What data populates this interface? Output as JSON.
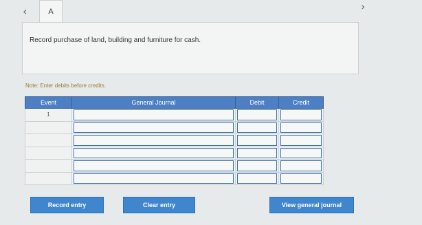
{
  "nav": {
    "prev_icon": "chevron-left-icon",
    "next_icon": "chevron-right-icon",
    "prev_glyph": "‹",
    "next_glyph": "›"
  },
  "tab": {
    "label": "A"
  },
  "instruction": "Record purchase of land, building and furniture for cash.",
  "note": "Note: Enter debits before credits.",
  "table": {
    "headers": {
      "event": "Event",
      "journal": "General Journal",
      "debit": "Debit",
      "credit": "Credit"
    },
    "rows": [
      {
        "event": "1"
      },
      {
        "event": ""
      },
      {
        "event": ""
      },
      {
        "event": ""
      },
      {
        "event": ""
      },
      {
        "event": ""
      }
    ]
  },
  "buttons": {
    "record": "Record entry",
    "clear": "Clear entry",
    "view": "View general journal"
  },
  "colors": {
    "accent": "#3f86cf",
    "header": "#4d7fc4",
    "note": "#9a7a3a"
  }
}
